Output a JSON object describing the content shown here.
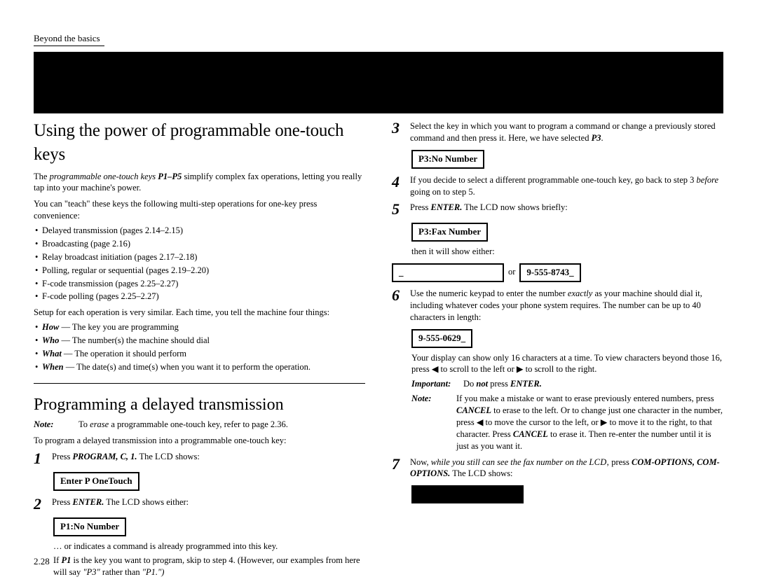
{
  "header": "Beyond the basics",
  "h1": "Using the power of programmable one-touch keys",
  "intro_prefix": "The ",
  "intro_em": "programmable one-touch keys ",
  "intro_keys": "P1–P5",
  "intro_rest": " simplify complex fax operations, letting you really tap into your machine's power.",
  "teach": "You can \"teach\" these keys the following multi-step operations for one-key press convenience:",
  "bullets": [
    "Delayed transmission (pages 2.14–2.15)",
    "Broadcasting (page 2.16)",
    "Relay broadcast initiation (pages 2.17–2.18)",
    "Polling, regular or sequential (pages 2.19–2.20)"
  ],
  "bullet5a": "F",
  "bullet5b": "-code transmission (pages 2.25–2.27)",
  "bullet6a": "F",
  "bullet6b": "-code polling (pages 2.25–2.27)",
  "setup": "Setup for each operation is very similar. Each time, you tell the machine four things:",
  "hw": [
    {
      "b": "How",
      "t": " — The key you are programming"
    },
    {
      "b": "Who",
      "t": " — The number(s) the machine should dial"
    },
    {
      "b": "What",
      "t": " — The operation it should perform"
    },
    {
      "b": "When",
      "t": " — The date(s) and time(s) when you want it to perform the operation."
    }
  ],
  "h2": "Programming a delayed transmission",
  "note1_label": "Note:",
  "note1_a": "To ",
  "note1_em": "erase",
  "note1_b": " a programmable one-touch key, refer to page 2.36.",
  "toprog": "To program a delayed transmission into a programmable one-touch key:",
  "s1a": "Press ",
  "s1b": "PROGRAM, C, 1.",
  "s1c": " The ",
  "s1d": "LCD",
  "s1e": " shows:",
  "lcd1": "Enter P OneTouch",
  "s2a": "Press ",
  "s2b": "ENTER.",
  "s2c": " The ",
  "s2d": "LCD",
  "s2e": " shows either:",
  "lcd2": "P1:No Number",
  "s2_or": "… or indicates a command is already programmed into this key.",
  "s2_if_a": "If ",
  "s2_if_b": "P1",
  "s2_if_c": " is the key you want to program, skip to step 4. (However, our examples from here will say ",
  "s2_if_d": "\"P3\"",
  "s2_if_e": " rather than ",
  "s2_if_f": "\"P1.\")",
  "s3a": "Select the key in which you want to program a command or change a previously stored command and then press it. Here, we have selected ",
  "s3b": "P3",
  "s3c": ".",
  "lcd3": "P3:No Number",
  "s4a": "If you decide to select a different programmable one-touch key, go back to step 3 ",
  "s4b": "before",
  "s4c": " going on to step 5.",
  "s5a": "Press ",
  "s5b": "ENTER.",
  "s5c": " The ",
  "s5d": "LCD",
  "s5e": " now shows briefly:",
  "lcd4": "P3:Fax Number",
  "then": "then it will show either:",
  "lcd5a": "_",
  "or_text": "or",
  "lcd5b": "9-555-8743_",
  "s6a": "Use the numeric keypad to enter the number ",
  "s6b": "exactly",
  "s6c": " as your machine should dial it, including whatever codes your phone system requires. The number can be up to 40 characters in length:",
  "lcd6": "9-555-0629_",
  "disp16": "Your display can show only 16 characters at a time. To view characters beyond those 16, press ◀ to scroll to the left or ▶ to scroll to the right.",
  "imp_label": "Important:",
  "imp_a": "Do ",
  "imp_b": "not ",
  "imp_c": "press ",
  "imp_d": "ENTER.",
  "note2_label": "Note:",
  "note2_a": "If you make a mistake or want to erase previously entered numbers, press ",
  "note2_b": "CANCEL",
  "note2_c": " to erase to the left. Or to change just one character in the number, press ◀ to move the cursor to the left, or ▶ to move it to the right, to that character. Press ",
  "note2_d": "CANCEL",
  "note2_e": " to erase it. Then re-enter the number until it is just as you want it.",
  "s7a": "Now, ",
  "s7b": "while you still can see the fax number on the ",
  "s7c": "LCD,",
  "s7s": " ",
  "s7d": "press ",
  "s7e": "COM-OPTIONS, COM-OPTIONS.",
  "s7f": " The ",
  "s7g": "LCD",
  "s7h": " shows:",
  "pagenum": "2.28"
}
